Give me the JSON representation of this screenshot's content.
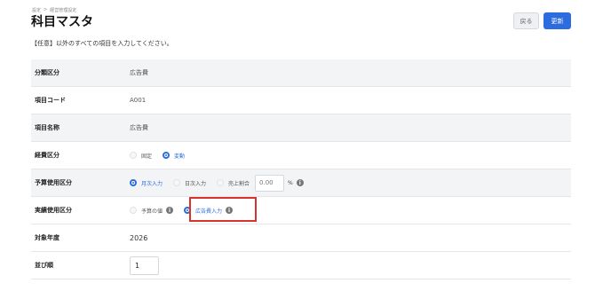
{
  "breadcrumb": {
    "items": [
      "設定",
      ">",
      "経営管理設定"
    ]
  },
  "header": {
    "title": "科目マスタ",
    "back_label": "戻る",
    "update_label": "更新"
  },
  "notice": "【任意】以外のすべての項目を入力してください。",
  "rows": {
    "category": {
      "label": "分類区分",
      "value": "広告費"
    },
    "code": {
      "label": "項目コード",
      "value": "A001"
    },
    "name": {
      "label": "項目名称",
      "value": "広告費"
    },
    "expense_type": {
      "label": "経費区分",
      "options": [
        "固定",
        "変動"
      ],
      "selected": "変動"
    },
    "budget_type": {
      "label": "予算使用区分",
      "options": [
        "月次入力",
        "日次入力",
        "売上割合"
      ],
      "selected": "月次入力",
      "rate_value": "0.00",
      "rate_unit": "%"
    },
    "actual_type": {
      "label": "実績使用区分",
      "options": [
        "予算の値",
        "広告費入力"
      ],
      "selected": "広告費入力"
    },
    "year": {
      "label": "対象年度",
      "value": "2026"
    },
    "order": {
      "label": "並び順",
      "value": "1"
    }
  },
  "colors": {
    "accent": "#2d6cdf",
    "highlight": "#d9342b"
  }
}
